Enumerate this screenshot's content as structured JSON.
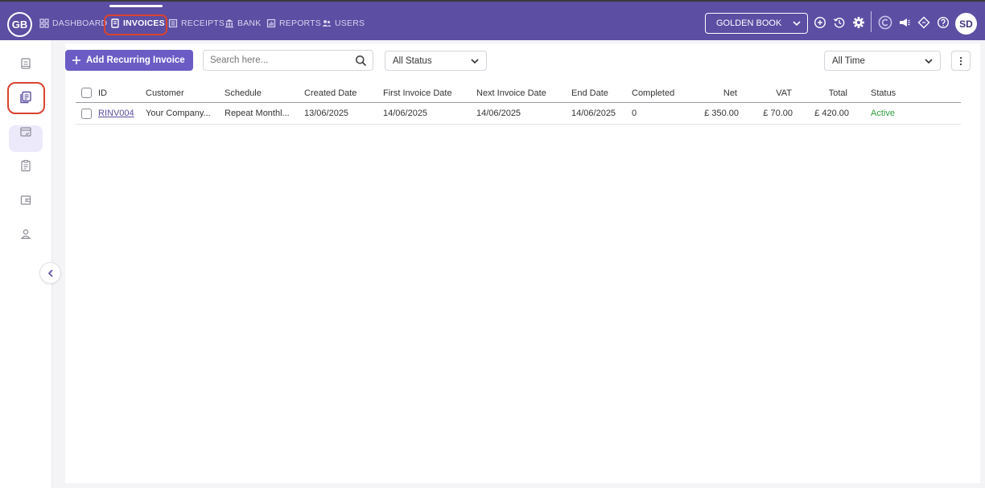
{
  "app": {
    "logo": "GB",
    "book_name": "GOLDEN BOOK",
    "user_initials": "SD"
  },
  "nav": {
    "items": [
      {
        "label": "DASHBOARD",
        "icon": "grid-icon"
      },
      {
        "label": "INVOICES",
        "icon": "invoice-icon",
        "active": true
      },
      {
        "label": "RECEIPTS",
        "icon": "receipt-icon"
      },
      {
        "label": "BANK",
        "icon": "bank-icon"
      },
      {
        "label": "REPORTS",
        "icon": "report-icon"
      },
      {
        "label": "USERS",
        "icon": "users-icon"
      }
    ]
  },
  "toolbar": {
    "add_label": "Add Recurring Invoice",
    "search_placeholder": "Search here...",
    "status_filter": "All Status",
    "time_filter": "All Time"
  },
  "table": {
    "headers": {
      "id": "ID",
      "customer": "Customer",
      "schedule": "Schedule",
      "created": "Created Date",
      "first": "First Invoice Date",
      "next": "Next Invoice Date",
      "end": "End Date",
      "completed": "Completed",
      "net": "Net",
      "vat": "VAT",
      "total": "Total",
      "status": "Status"
    },
    "rows": [
      {
        "id": "RINV004",
        "customer": "Your Company...",
        "schedule": "Repeat Monthl...",
        "created": "13/06/2025",
        "first": "14/06/2025",
        "next": "14/06/2025",
        "end": "14/06/2025",
        "completed": "0",
        "net": "£ 350.00",
        "vat": "£ 70.00",
        "total": "£ 420.00",
        "status": "Active"
      }
    ]
  },
  "colors": {
    "brand": "#5b4ea3",
    "button": "#6a5cc4",
    "highlight": "#d9432f",
    "status_active": "#2e9d3e"
  }
}
